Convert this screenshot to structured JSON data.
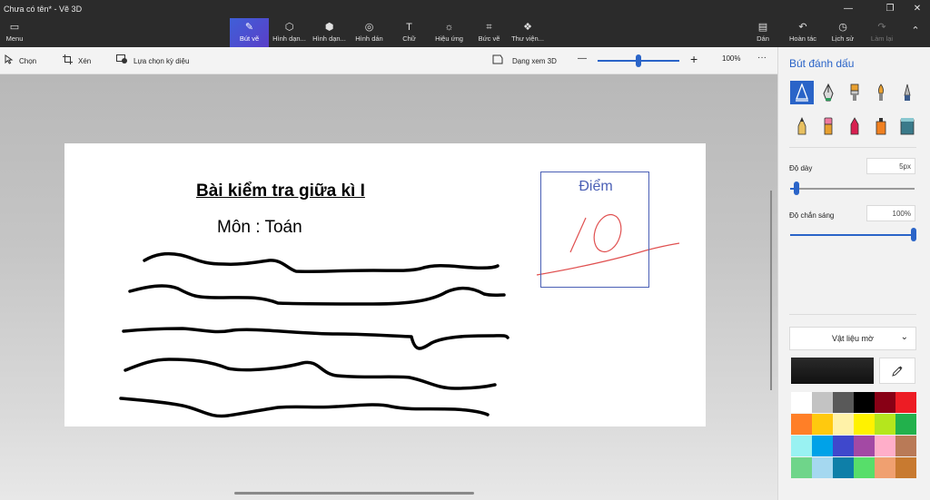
{
  "window": {
    "title": "Chưa có tên* - Vẽ 3D",
    "controls": {
      "minimize": "—",
      "restore": "❐",
      "close": "✕"
    }
  },
  "toolbar": {
    "menu_label": "Menu",
    "tools": [
      {
        "label": "Bút vẽ",
        "icon": "brush-icon",
        "glyph": "✎"
      },
      {
        "label": "Hình dạn...",
        "icon": "2d-shapes-icon",
        "glyph": "⬡"
      },
      {
        "label": "Hình dạn...",
        "icon": "3d-shapes-icon",
        "glyph": "⬢"
      },
      {
        "label": "Hình dán",
        "icon": "sticker-icon",
        "glyph": "◎"
      },
      {
        "label": "Chữ",
        "icon": "text-icon",
        "glyph": "T"
      },
      {
        "label": "Hiệu ứng",
        "icon": "effects-icon",
        "glyph": "☼"
      },
      {
        "label": "Bức vẽ",
        "icon": "canvas-icon",
        "glyph": "⌗"
      },
      {
        "label": "Thư viện...",
        "icon": "library-icon",
        "glyph": "❖"
      }
    ],
    "right": [
      {
        "label": "Dán",
        "icon": "paste-icon",
        "glyph": "▤"
      },
      {
        "label": "Hoàn tác",
        "icon": "undo-icon",
        "glyph": "↶"
      },
      {
        "label": "Lịch sử",
        "icon": "history-icon",
        "glyph": "◷"
      },
      {
        "label": "Làm lại",
        "icon": "redo-icon",
        "glyph": "↷"
      }
    ],
    "collapse_glyph": "⌃"
  },
  "subbar": {
    "select": "Chọn",
    "crop": "Xén",
    "magic_select": "Lựa chọn kỳ diệu",
    "view_3d": "Dạng xem 3D",
    "zoom_minus": "—",
    "zoom_plus": "+",
    "zoom_level": "100%",
    "more": "···"
  },
  "document": {
    "title": "Bài kiểm tra giữa kì I",
    "subject": "Môn : Toán",
    "score_label": "Điểm"
  },
  "panel": {
    "title": "Bút đánh dấu",
    "thickness_label": "Độ dày",
    "thickness_value": "5px",
    "opacity_label": "Độ chắn sáng",
    "opacity_value": "100%",
    "material": "Vật liệu mờ",
    "thickness_fraction": 0.05,
    "opacity_fraction": 1.0,
    "tools": [
      "marker-icon",
      "calligraphy-pen-icon",
      "oil-brush-icon",
      "watercolor-icon",
      "pixel-pen-icon",
      "pencil-icon",
      "eraser-icon",
      "crayon-icon",
      "spray-can-icon",
      "fill-icon"
    ],
    "colors": [
      "#ffffff",
      "#c3c3c3",
      "#595959",
      "#000000",
      "#880015",
      "#ed1c24",
      "#ff7f27",
      "#ffc90e",
      "#fff2a8",
      "#fff200",
      "#b5e61d",
      "#22b14c",
      "#99f2f2",
      "#00a2e8",
      "#3f48cc",
      "#a349a4",
      "#ffaec9",
      "#b97a57",
      "#6fd58a",
      "#a5d8f0",
      "#0e7fa8",
      "#57de6a",
      "#f0a070",
      "#c87a30"
    ]
  }
}
